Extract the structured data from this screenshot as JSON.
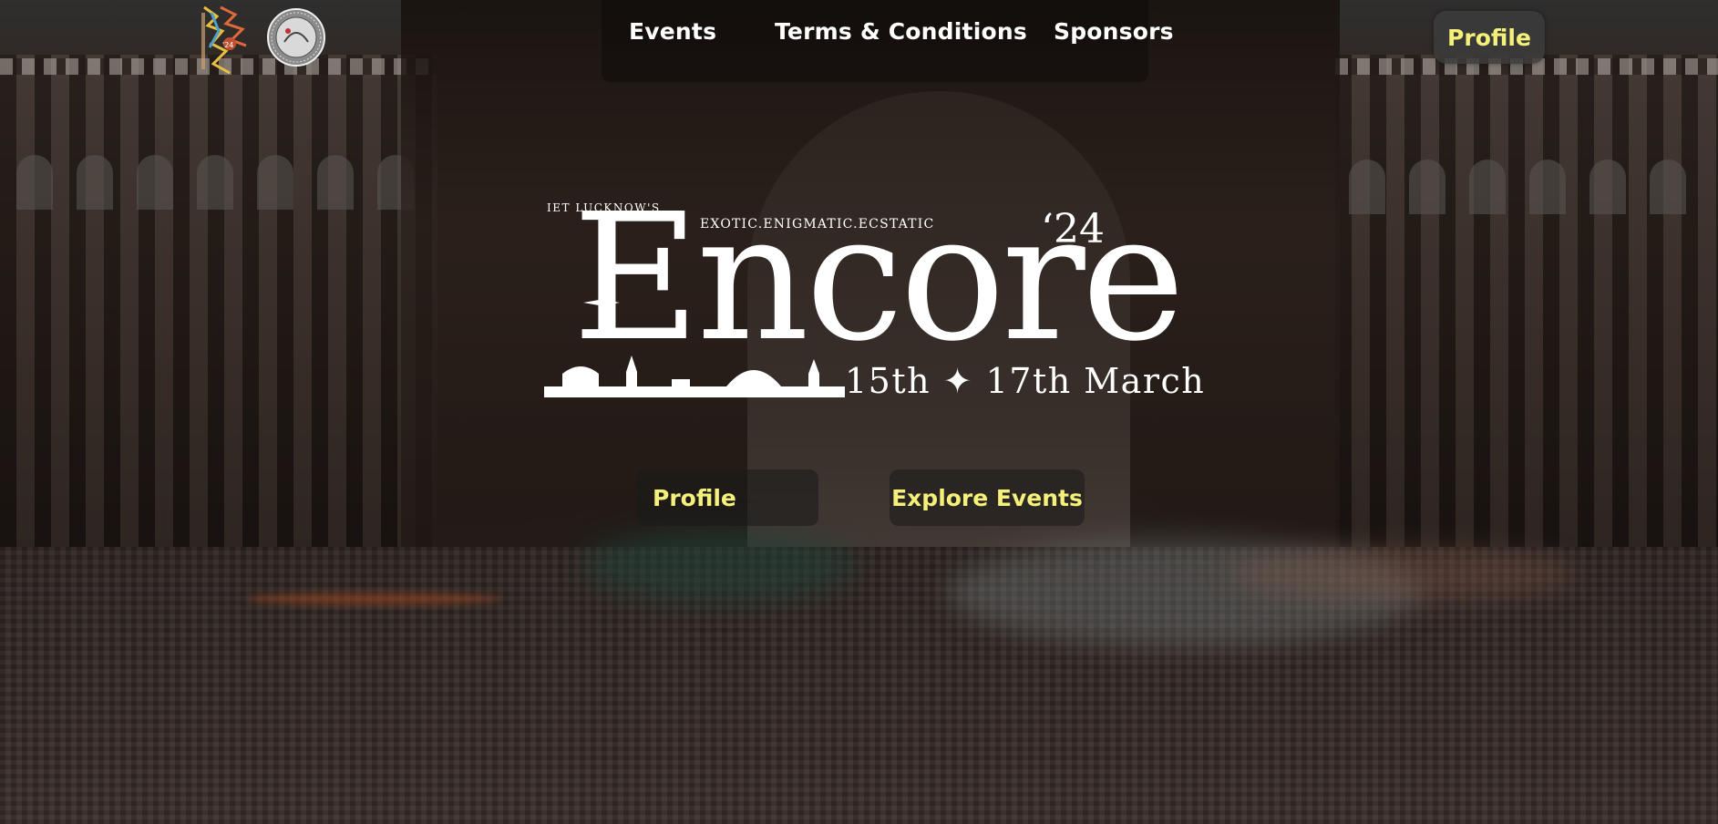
{
  "nav": {
    "links": [
      {
        "label": "Events"
      },
      {
        "label": "Terms & Conditions"
      },
      {
        "label": "Sponsors"
      }
    ],
    "profile_label": "Profile"
  },
  "hero": {
    "presenter": "IET LUCKNOW'S",
    "tagline": "EXOTIC.ENIGMATIC.ECSTATIC",
    "title": "Encore",
    "year": "‘24",
    "dates": "15th ✦ 17th March"
  },
  "cta": {
    "profile_label": "Profile",
    "explore_label": "Explore Events"
  },
  "colors": {
    "accent_yellow": "#f4f07a",
    "text_white": "#ffffff",
    "button_bg": "#3c3c3c"
  },
  "icons": {
    "encore_logo": "encore-logo-icon",
    "iet_logo": "iet-logo-icon"
  }
}
